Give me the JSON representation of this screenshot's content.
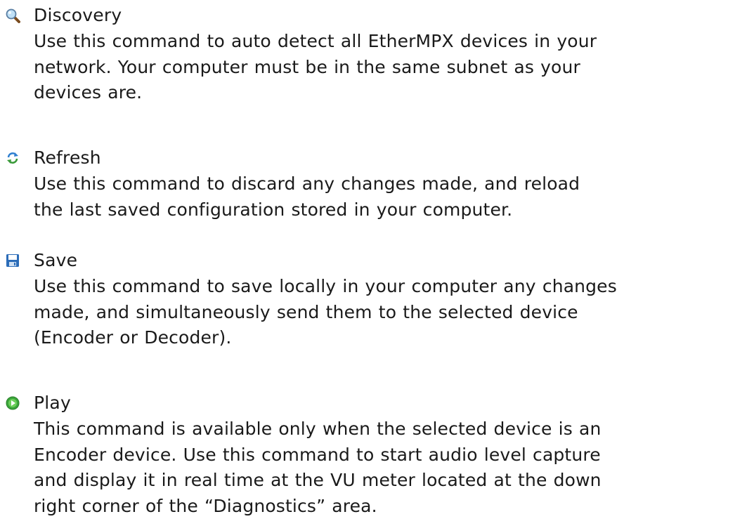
{
  "commands": [
    {
      "icon": "magnifier-icon",
      "title": "Discovery",
      "lines": [
        "Use this command to auto detect all EtherMPX devices in your",
        "network. Your computer must be in the same subnet as your",
        "devices are."
      ]
    },
    {
      "icon": "refresh-icon",
      "title": "Refresh",
      "lines": [
        "Use this command to discard any changes made, and reload",
        "the last saved configuration stored in your computer."
      ]
    },
    {
      "icon": "floppy-disk-icon",
      "title": "Save",
      "lines": [
        "Use this command to save locally in your computer any changes",
        "made, and simultaneously send them to the selected device",
        "(Encoder or Decoder)."
      ]
    },
    {
      "icon": "play-icon",
      "title": "Play",
      "lines": [
        "This command is available only when the selected device is an",
        "Encoder device. Use this command to start audio level capture",
        "and display it in real time at the VU meter located at the down",
        "right corner of the “Diagnostics” area."
      ]
    }
  ]
}
